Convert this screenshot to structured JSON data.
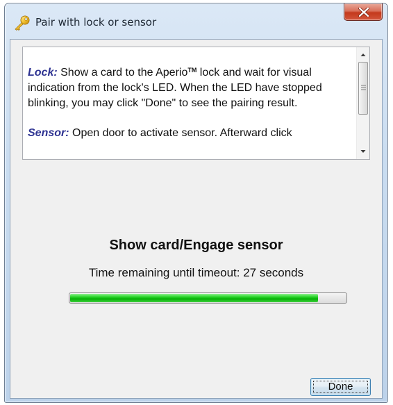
{
  "window": {
    "title": "Pair with lock or sensor",
    "title_icon": "key-icon",
    "close_icon": "close-icon"
  },
  "instructions": {
    "lock_term": "Lock:",
    "lock_text_before_tm": " Show a card to the Aperio",
    "tm_mark": "TM",
    "lock_text_after_tm": " lock and wait for visual indication from the lock's LED. When the LED have stopped blinking, you may click \"Done\" to see the pairing result.",
    "sensor_term": "Sensor:",
    "sensor_text": " Open door to activate sensor. Afterward click",
    "scroll_up_icon": "scroll-up-arrow-icon",
    "scroll_down_icon": "scroll-down-arrow-icon"
  },
  "status": {
    "heading": "Show card/Engage sensor",
    "timeout_text": "Time remaining until timeout: 27 seconds",
    "progress_fraction": 0.9
  },
  "buttons": {
    "done_label": "Done"
  },
  "colors": {
    "term": "#2e3392",
    "progress_green": "#06b006",
    "close_red": "#c4391c"
  }
}
